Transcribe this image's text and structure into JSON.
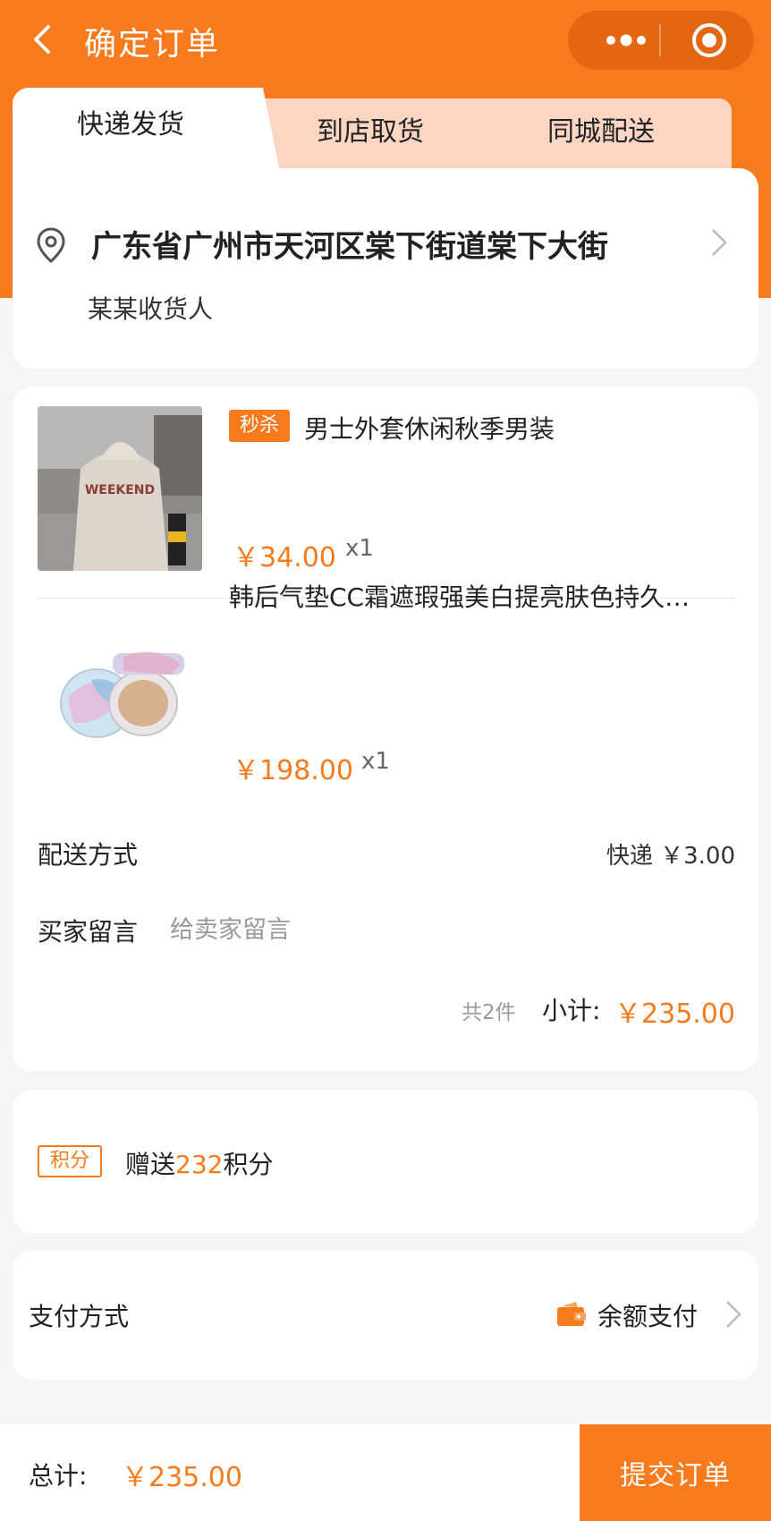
{
  "header": {
    "title": "确定订单",
    "back_icon": "back-arrow-icon",
    "more_icon": "more-dots-icon",
    "close_icon": "capsule-target-icon"
  },
  "tabs": [
    {
      "label": "快递发货",
      "active": true
    },
    {
      "label": "到店取货",
      "active": false
    },
    {
      "label": "同城配送",
      "active": false
    }
  ],
  "address": {
    "text": "广东省广州市天河区棠下街道棠下大街",
    "receiver": "某某收货人",
    "icon": "location-pin-icon"
  },
  "items": [
    {
      "tag": "秒杀",
      "name": "男士外套休闲秋季男装",
      "price": "￥34.00",
      "qty": "x1"
    },
    {
      "tag": "",
      "name": "韩后气垫CC霜遮瑕强美白提亮肤色持久…",
      "price": "￥198.00",
      "qty": "x1"
    }
  ],
  "delivery": {
    "label": "配送方式",
    "value": "快递 ￥3.00"
  },
  "message": {
    "label": "买家留言",
    "placeholder": "给卖家留言",
    "value": ""
  },
  "subtotal": {
    "count": "共2件",
    "label": "小计:",
    "amount": "￥235.00"
  },
  "points": {
    "tag": "积分",
    "prefix": "赠送",
    "num": "232",
    "suffix": "积分"
  },
  "payment": {
    "label": "支付方式",
    "value": "余额支付",
    "icon": "wallet-icon"
  },
  "footer": {
    "total_label": "总计:",
    "total_amount": "￥235.00",
    "submit": "提交订单"
  },
  "colors": {
    "accent": "#f77a1c",
    "tab_inactive": "#fcd6c2",
    "background": "#f5f5f5"
  }
}
